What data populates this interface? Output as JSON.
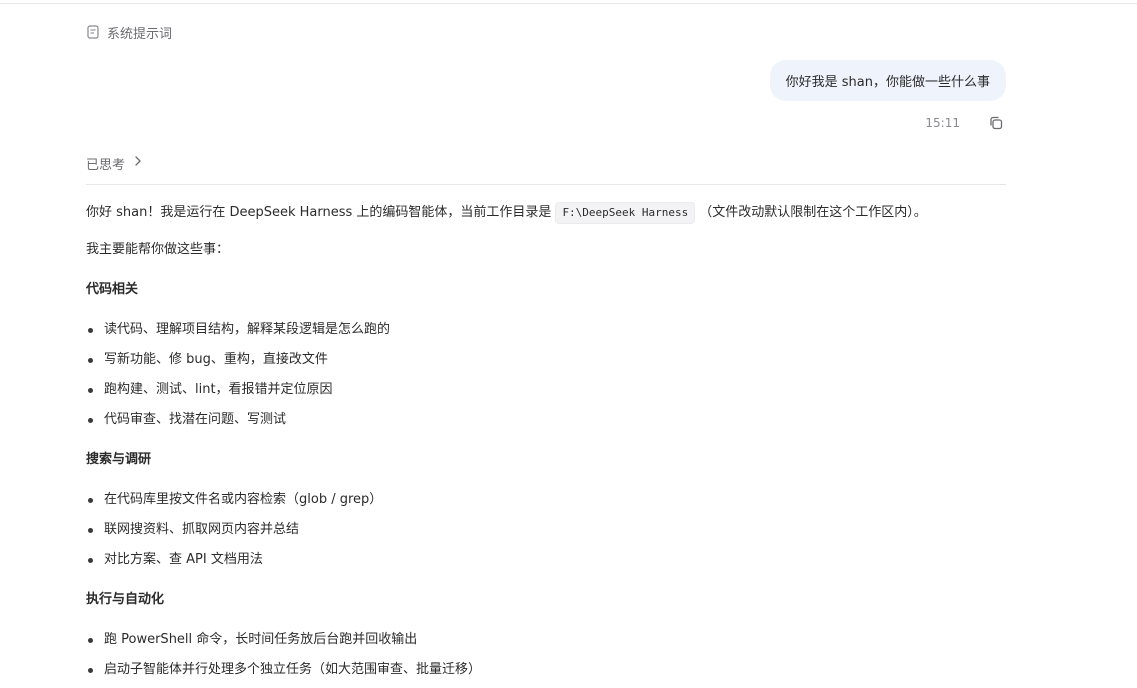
{
  "system_prompt": {
    "label": "系统提示词"
  },
  "user_message": {
    "text": "你好我是 shan，你能做一些什么事",
    "time": "15:11"
  },
  "thinking": {
    "label": "已思考"
  },
  "answer": {
    "intro_before": "你好 shan！我是运行在 DeepSeek Harness 上的编码智能体，当前工作目录是",
    "workdir": "F:\\DeepSeek Harness",
    "intro_after": "（文件改动默认限制在这个工作区内）。",
    "lead": "我主要能帮你做这些事：",
    "sections": [
      {
        "title": "代码相关",
        "items": [
          "读代码、理解项目结构，解释某段逻辑是怎么跑的",
          "写新功能、修 bug、重构，直接改文件",
          "跑构建、测试、lint，看报错并定位原因",
          "代码审查、找潜在问题、写测试"
        ]
      },
      {
        "title": "搜索与调研",
        "items": [
          "在代码库里按文件名或内容检索（glob / grep）",
          "联网搜资料、抓取网页内容并总结",
          "对比方案、查 API 文档用法"
        ]
      },
      {
        "title": "执行与自动化",
        "items": [
          "跑 PowerShell 命令，长时间任务放后台跑并回收输出",
          "启动子智能体并行处理多个独立任务（如大范围审查、批量迁移）"
        ]
      }
    ]
  }
}
